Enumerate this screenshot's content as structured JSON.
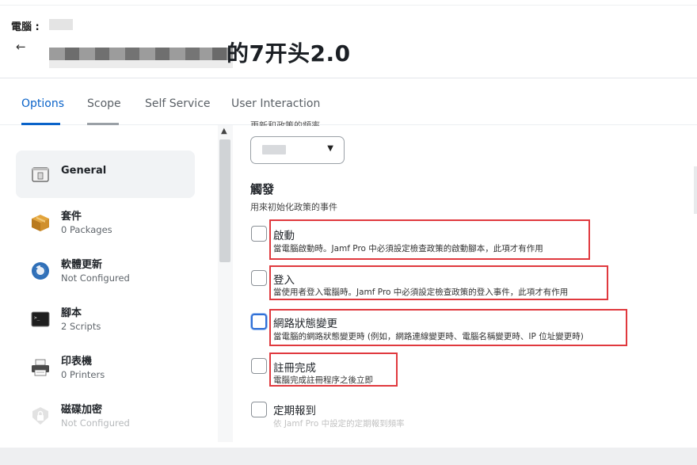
{
  "header": {
    "breadcrumb": "電腦 :",
    "back_icon": "←",
    "title_visible": "的7开头2.0"
  },
  "tabs": [
    {
      "label": "Options",
      "active": true
    },
    {
      "label": "Scope",
      "active": false
    },
    {
      "label": "Self Service",
      "active": false
    },
    {
      "label": "User Interaction",
      "active": false
    }
  ],
  "sidebar": {
    "items": [
      {
        "title": "General",
        "sub": "",
        "icon": "general-window-icon",
        "active": true
      },
      {
        "title": "套件",
        "sub": "0 Packages",
        "icon": "package-box-icon"
      },
      {
        "title": "軟體更新",
        "sub": "Not Configured",
        "icon": "software-update-icon"
      },
      {
        "title": "腳本",
        "sub": "2 Scripts",
        "icon": "terminal-script-icon"
      },
      {
        "title": "印表機",
        "sub": "0 Printers",
        "icon": "printer-icon"
      },
      {
        "title": "磁碟加密",
        "sub": "Not Configured",
        "icon": "disk-encryption-icon"
      }
    ]
  },
  "main": {
    "cut_label": "更新和政策的頻率",
    "trigger_section": {
      "title": "觸發",
      "desc": "用來初始化政策的事件"
    },
    "options": [
      {
        "title": "啟動",
        "desc": "當電腦啟動時。Jamf Pro 中必須設定檢查政策的啟動腳本，此項才有作用",
        "checked": false
      },
      {
        "title": "登入",
        "desc": "當使用者登入電腦時。Jamf Pro 中必須設定檢查政策的登入事件，此項才有作用",
        "checked": false
      },
      {
        "title": "網路狀態變更",
        "desc": "當電腦的網路狀態變更時 (例如，網路連線變更時、電腦名稱變更時、IP 位址變更時)",
        "checked": false
      },
      {
        "title": "註冊完成",
        "desc": "電腦完成註冊程序之後立即",
        "checked": false
      },
      {
        "title": "定期報到",
        "desc": "依 Jamf Pro 中設定的定期報到頻率",
        "checked": false
      }
    ]
  },
  "colors": {
    "accent": "#0a63c9",
    "highlight": "#e0393e"
  }
}
